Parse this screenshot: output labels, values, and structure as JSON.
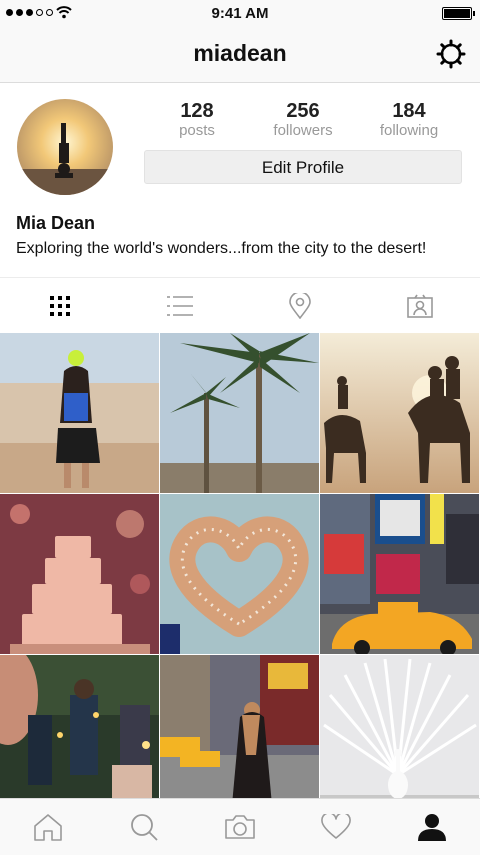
{
  "status": {
    "time": "9:41 AM"
  },
  "header": {
    "username": "miadean"
  },
  "profile": {
    "stats": [
      {
        "value": "128",
        "label": "posts"
      },
      {
        "value": "256",
        "label": "followers"
      },
      {
        "value": "184",
        "label": "following"
      }
    ],
    "edit_label": "Edit Profile",
    "name": "Mia Dean",
    "bio": "Exploring the world's wonders...from the city to the desert!"
  },
  "tabs": [
    "grid-icon",
    "list-icon",
    "location-pin-icon",
    "tagged-portrait-icon"
  ],
  "grid": [
    {
      "subject": "hiker-in-desert"
    },
    {
      "subject": "palm-trees"
    },
    {
      "subject": "camel-riders"
    },
    {
      "subject": "wedding-cake"
    },
    {
      "subject": "heart-pretzels"
    },
    {
      "subject": "times-square-taxi"
    },
    {
      "subject": "candles"
    },
    {
      "subject": "city-street"
    },
    {
      "subject": "white-peacock"
    }
  ],
  "nav": [
    "home-icon",
    "search-icon",
    "camera-icon",
    "heart-icon",
    "profile-icon"
  ],
  "colors": {
    "accent": "#000000",
    "muted": "#999999",
    "divider": "#dcdcdc"
  }
}
